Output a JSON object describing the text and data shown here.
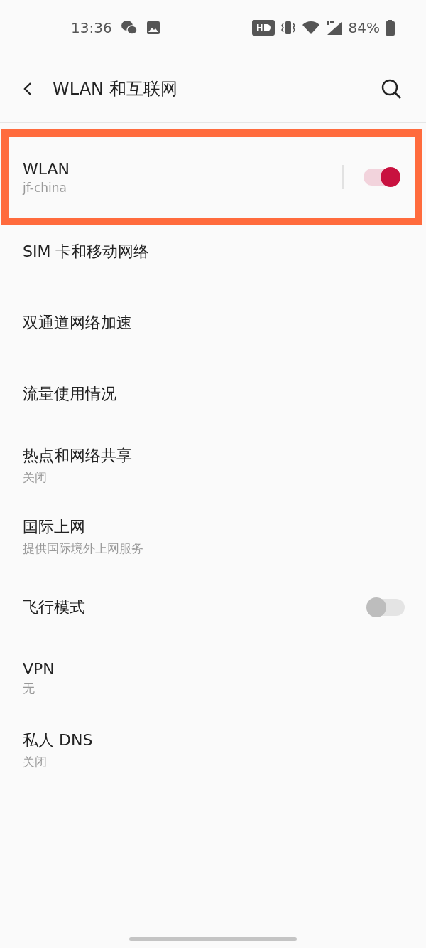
{
  "status_bar": {
    "time": "13:36",
    "battery": "84%"
  },
  "header": {
    "title": "WLAN 和互联网"
  },
  "items": [
    {
      "title": "WLAN",
      "subtitle": "jf-china",
      "kind": "switch",
      "on": true,
      "divider": true,
      "highlighted": true
    },
    {
      "title": "SIM 卡和移动网络",
      "kind": "link"
    },
    {
      "title": "双通道网络加速",
      "kind": "link"
    },
    {
      "title": "流量使用情况",
      "kind": "link"
    },
    {
      "title": "热点和网络共享",
      "subtitle": "关闭",
      "kind": "link"
    },
    {
      "title": "国际上网",
      "subtitle": "提供国际境外上网服务",
      "kind": "link"
    },
    {
      "title": "飞行模式",
      "kind": "switch",
      "on": false
    },
    {
      "title": "VPN",
      "subtitle": "无",
      "kind": "link"
    },
    {
      "title": "私人 DNS",
      "subtitle": "关闭",
      "kind": "link"
    }
  ]
}
